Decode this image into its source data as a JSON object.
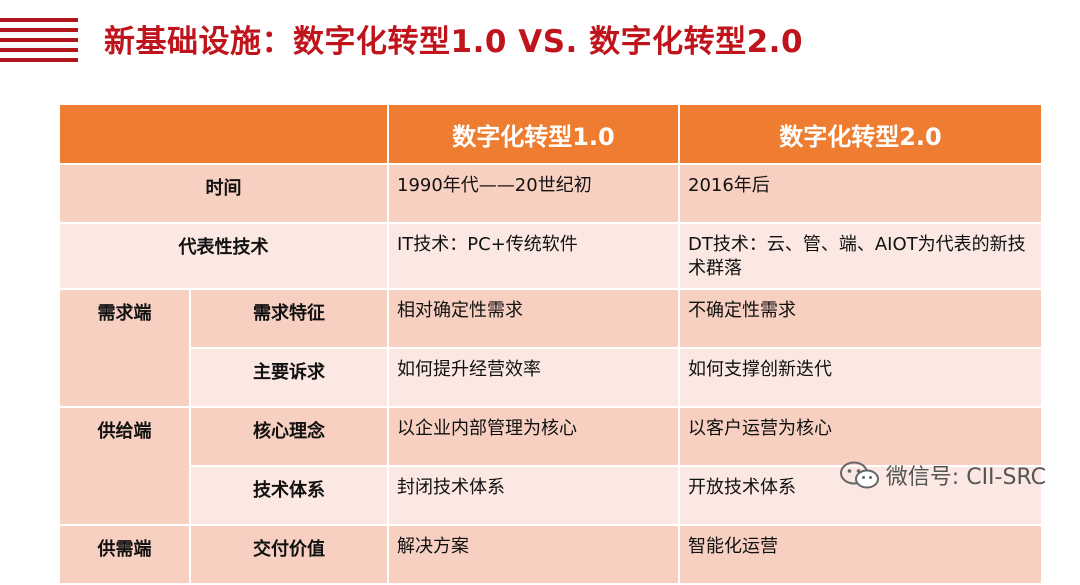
{
  "title": "新基础设施：数字化转型1.0 VS. 数字化转型2.0",
  "table": {
    "headers": [
      "",
      "数字化转型1.0",
      "数字化转型2.0"
    ],
    "rows": [
      {
        "group": "",
        "label": "时间",
        "v1": "1990年代——20世纪初",
        "v2": "2016年后"
      },
      {
        "group": "",
        "label": "代表性技术",
        "v1": "IT技术：PC+传统软件",
        "v2": "DT技术：云、管、端、AIOT为代表的新技术群落"
      },
      {
        "group": "需求端",
        "label": "需求特征",
        "v1": "相对确定性需求",
        "v2": "不确定性需求"
      },
      {
        "group": "",
        "label": "主要诉求",
        "v1": "如何提升经营效率",
        "v2": "如何支撑创新迭代"
      },
      {
        "group": "供给端",
        "label": "核心理念",
        "v1": "以企业内部管理为核心",
        "v2": "以客户运营为核心"
      },
      {
        "group": "",
        "label": "技术体系",
        "v1": "封闭技术体系",
        "v2": "开放技术体系"
      },
      {
        "group": "供需端",
        "label": "交付价值",
        "v1": "解决方案",
        "v2": "智能化运营"
      }
    ]
  },
  "watermark": {
    "text": "微信号: CII-SRC",
    "icon": "wechat-icon"
  },
  "colors": {
    "accent": "#c0141c",
    "header": "#ee7d31",
    "row_dark": "#f7d0c1",
    "row_light": "#fbe8e2"
  }
}
